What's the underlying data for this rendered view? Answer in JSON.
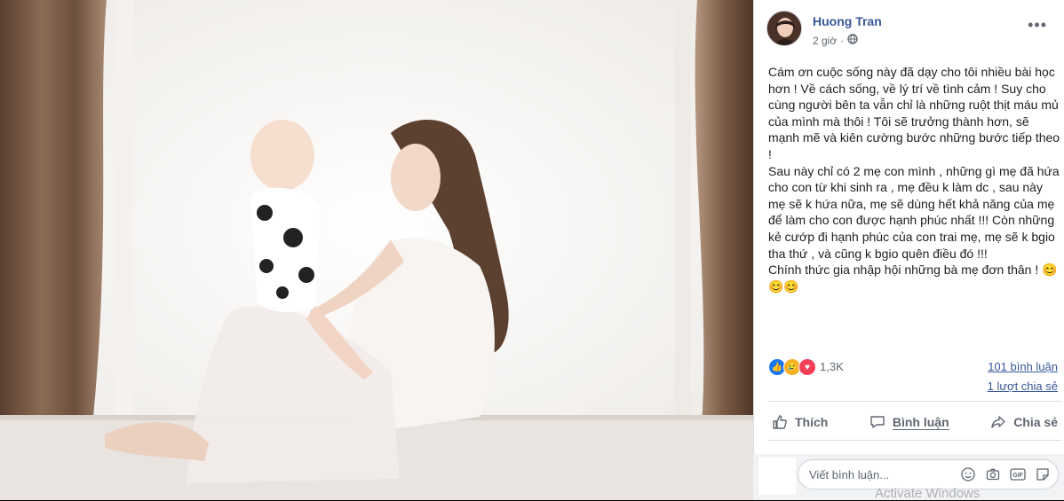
{
  "post": {
    "author": "Huong Tran",
    "time": "2 giờ",
    "privacy_icon": "globe-icon",
    "paragraphs": [
      "Cám ơn cuộc sống này đã dạy cho tôi nhiều bài học hơn ! Về cách sống, về lý trí về tình cảm ! Suy cho cùng người bên ta vẫn chỉ là những ruột thịt máu mủ của mình mà thôi ! Tôi sẽ trưởng thành hơn, sẽ mạnh mẽ và kiên cường bước những bước tiếp theo !",
      "Sau này chỉ có 2 mẹ con mình , những gì mẹ đã hứa cho con từ khi sinh ra , mẹ đều k làm dc , sau này mẹ sẽ k hứa nữa, mẹ sẽ dùng hết khả năng của mẹ để làm cho con được hạnh phúc nhất !!! Còn những kẻ cướp đi hạnh phúc của con trai mẹ, mẹ sẽ k bgio tha thứ , và cũng k bgio quên điều đó !!!",
      "Chính thức gia nhập hội những bà mẹ đơn thân ! 😊😊😊"
    ]
  },
  "stats": {
    "reaction_count": "1,3K",
    "reaction_icons": [
      "like-icon",
      "sad-icon",
      "love-icon"
    ],
    "comments": "101 bình luận",
    "shares": "1 lượt chia sẻ"
  },
  "actions": {
    "like": "Thích",
    "comment": "Bình luận",
    "share": "Chia sẻ"
  },
  "comment_box": {
    "placeholder": "Viết bình luận..."
  },
  "watermark": "Activate Windows",
  "colors": {
    "link": "#385898",
    "like": "#1877f2",
    "love": "#f33e58",
    "sad": "#f7b125"
  }
}
